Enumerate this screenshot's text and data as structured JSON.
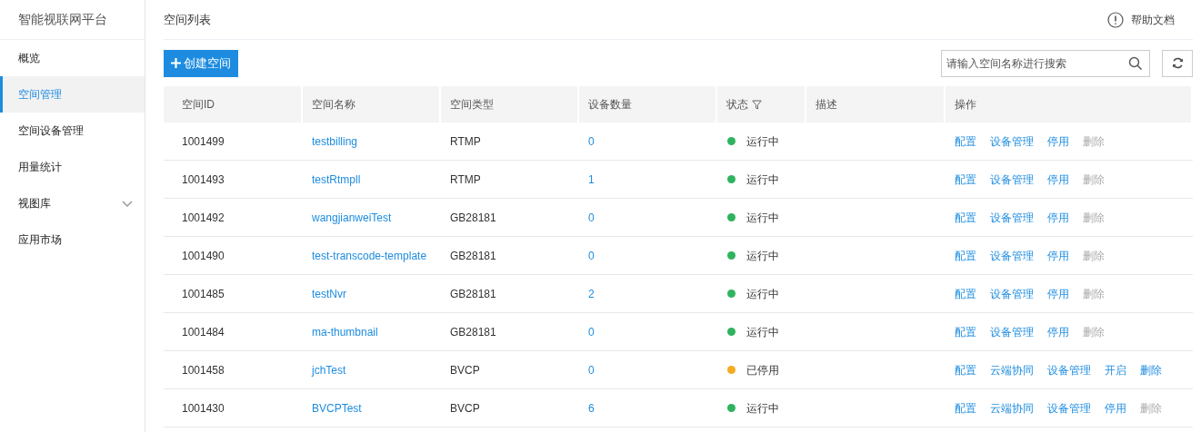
{
  "sidebar": {
    "brand": "智能视联网平台",
    "items": [
      {
        "label": "概览",
        "selected": false
      },
      {
        "label": "空间管理",
        "selected": true
      },
      {
        "label": "空间设备管理",
        "selected": false
      },
      {
        "label": "用量统计",
        "selected": false
      },
      {
        "label": "视图库",
        "selected": false,
        "expanded": false
      },
      {
        "label": "应用市场",
        "selected": false
      }
    ]
  },
  "header": {
    "title": "空间列表",
    "help": "帮助文档"
  },
  "toolbar": {
    "create_button": "创建空间",
    "search": {
      "placeholder": "请输入空间名称进行搜索"
    }
  },
  "table": {
    "columns": [
      "空间ID",
      "空间名称",
      "空间类型",
      "设备数量",
      "状态",
      "描述",
      "操作"
    ],
    "rows": [
      {
        "id": "1001499",
        "name": "testbilling",
        "type": "RTMP",
        "devices": "0",
        "status": "运行中",
        "color": "#2fb35f",
        "actions": [
          {
            "label": "配置",
            "disabled": false
          },
          {
            "label": "设备管理",
            "disabled": false
          },
          {
            "label": "停用",
            "disabled": false
          },
          {
            "label": "删除",
            "disabled": true
          }
        ]
      },
      {
        "id": "1001493",
        "name": "testRtmpll",
        "type": "RTMP",
        "devices": "1",
        "status": "运行中",
        "color": "#2fb35f",
        "actions": [
          {
            "label": "配置",
            "disabled": false
          },
          {
            "label": "设备管理",
            "disabled": false
          },
          {
            "label": "停用",
            "disabled": false
          },
          {
            "label": "删除",
            "disabled": true
          }
        ]
      },
      {
        "id": "1001492",
        "name": "wangjianweiTest",
        "type": "GB28181",
        "devices": "0",
        "status": "运行中",
        "color": "#2fb35f",
        "actions": [
          {
            "label": "配置",
            "disabled": false
          },
          {
            "label": "设备管理",
            "disabled": false
          },
          {
            "label": "停用",
            "disabled": false
          },
          {
            "label": "删除",
            "disabled": true
          }
        ]
      },
      {
        "id": "1001490",
        "name": "test-transcode-template",
        "type": "GB28181",
        "devices": "0",
        "status": "运行中",
        "color": "#2fb35f",
        "actions": [
          {
            "label": "配置",
            "disabled": false
          },
          {
            "label": "设备管理",
            "disabled": false
          },
          {
            "label": "停用",
            "disabled": false
          },
          {
            "label": "删除",
            "disabled": true
          }
        ]
      },
      {
        "id": "1001485",
        "name": "testNvr",
        "type": "GB28181",
        "devices": "2",
        "status": "运行中",
        "color": "#2fb35f",
        "actions": [
          {
            "label": "配置",
            "disabled": false
          },
          {
            "label": "设备管理",
            "disabled": false
          },
          {
            "label": "停用",
            "disabled": false
          },
          {
            "label": "删除",
            "disabled": true
          }
        ]
      },
      {
        "id": "1001484",
        "name": "ma-thumbnail",
        "type": "GB28181",
        "devices": "0",
        "status": "运行中",
        "color": "#2fb35f",
        "actions": [
          {
            "label": "配置",
            "disabled": false
          },
          {
            "label": "设备管理",
            "disabled": false
          },
          {
            "label": "停用",
            "disabled": false
          },
          {
            "label": "删除",
            "disabled": true
          }
        ]
      },
      {
        "id": "1001458",
        "name": "jchTest",
        "type": "BVCP",
        "devices": "0",
        "status": "已停用",
        "color": "#f5ab22",
        "actions": [
          {
            "label": "配置",
            "disabled": false
          },
          {
            "label": "云端协同",
            "disabled": false
          },
          {
            "label": "设备管理",
            "disabled": false
          },
          {
            "label": "开启",
            "disabled": false
          },
          {
            "label": "删除",
            "disabled": false
          }
        ]
      },
      {
        "id": "1001430",
        "name": "BVCPTest",
        "type": "BVCP",
        "devices": "6",
        "status": "运行中",
        "color": "#2fb35f",
        "actions": [
          {
            "label": "配置",
            "disabled": false
          },
          {
            "label": "云端协同",
            "disabled": false
          },
          {
            "label": "设备管理",
            "disabled": false
          },
          {
            "label": "停用",
            "disabled": false
          },
          {
            "label": "删除",
            "disabled": true
          }
        ]
      }
    ]
  }
}
